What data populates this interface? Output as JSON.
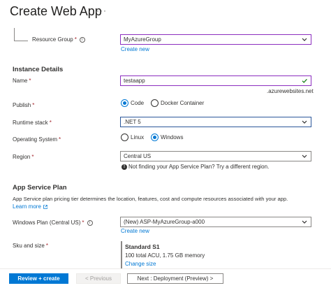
{
  "header": {
    "title": "Create Web App",
    "more_label": "···"
  },
  "resource_group": {
    "label": "Resource Group",
    "required_mark": "*",
    "info_icon": "i",
    "value": "MyAzureGroup",
    "create_new": "Create new"
  },
  "instance_details": {
    "heading": "Instance Details",
    "name": {
      "label": "Name",
      "required_mark": "*",
      "value": "testaapp",
      "suffix": ".azurewebsites.net"
    },
    "publish": {
      "label": "Publish",
      "required_mark": "*",
      "options": [
        "Code",
        "Docker Container"
      ],
      "selected": "Code"
    },
    "runtime_stack": {
      "label": "Runtime stack",
      "required_mark": "*",
      "value": ".NET 5"
    },
    "operating_system": {
      "label": "Operating System",
      "required_mark": "*",
      "options": [
        "Linux",
        "Windows"
      ],
      "selected": "Windows"
    },
    "region": {
      "label": "Region",
      "required_mark": "*",
      "value": "Central US",
      "info_icon": "!",
      "note": "Not finding your App Service Plan? Try a different region."
    }
  },
  "app_service_plan": {
    "heading": "App Service Plan",
    "description_line1": "App Service plan pricing tier determines the location, features, cost and compute resources associated with your app.",
    "learn_more": "Learn more",
    "windows_plan": {
      "label": "Windows Plan (Central US)",
      "required_mark": "*",
      "info_icon": "i",
      "value": "(New) ASP-MyAzureGroup-a000",
      "create_new": "Create new"
    },
    "sku": {
      "label": "Sku and size",
      "required_mark": "*",
      "tier": "Standard S1",
      "details": "100 total ACU, 1.75 GB memory",
      "change_link": "Change size"
    }
  },
  "footer": {
    "review_create": "Review + create",
    "previous": "< Previous",
    "next": "Next : Deployment (Preview) >"
  },
  "colors": {
    "accent": "#0078d4",
    "validated_border": "#8c2ebf",
    "check_green": "#107c10"
  },
  "icons": [
    "more-icon",
    "info-icon",
    "chevron-down-icon",
    "checkmark-icon",
    "external-link-icon"
  ]
}
